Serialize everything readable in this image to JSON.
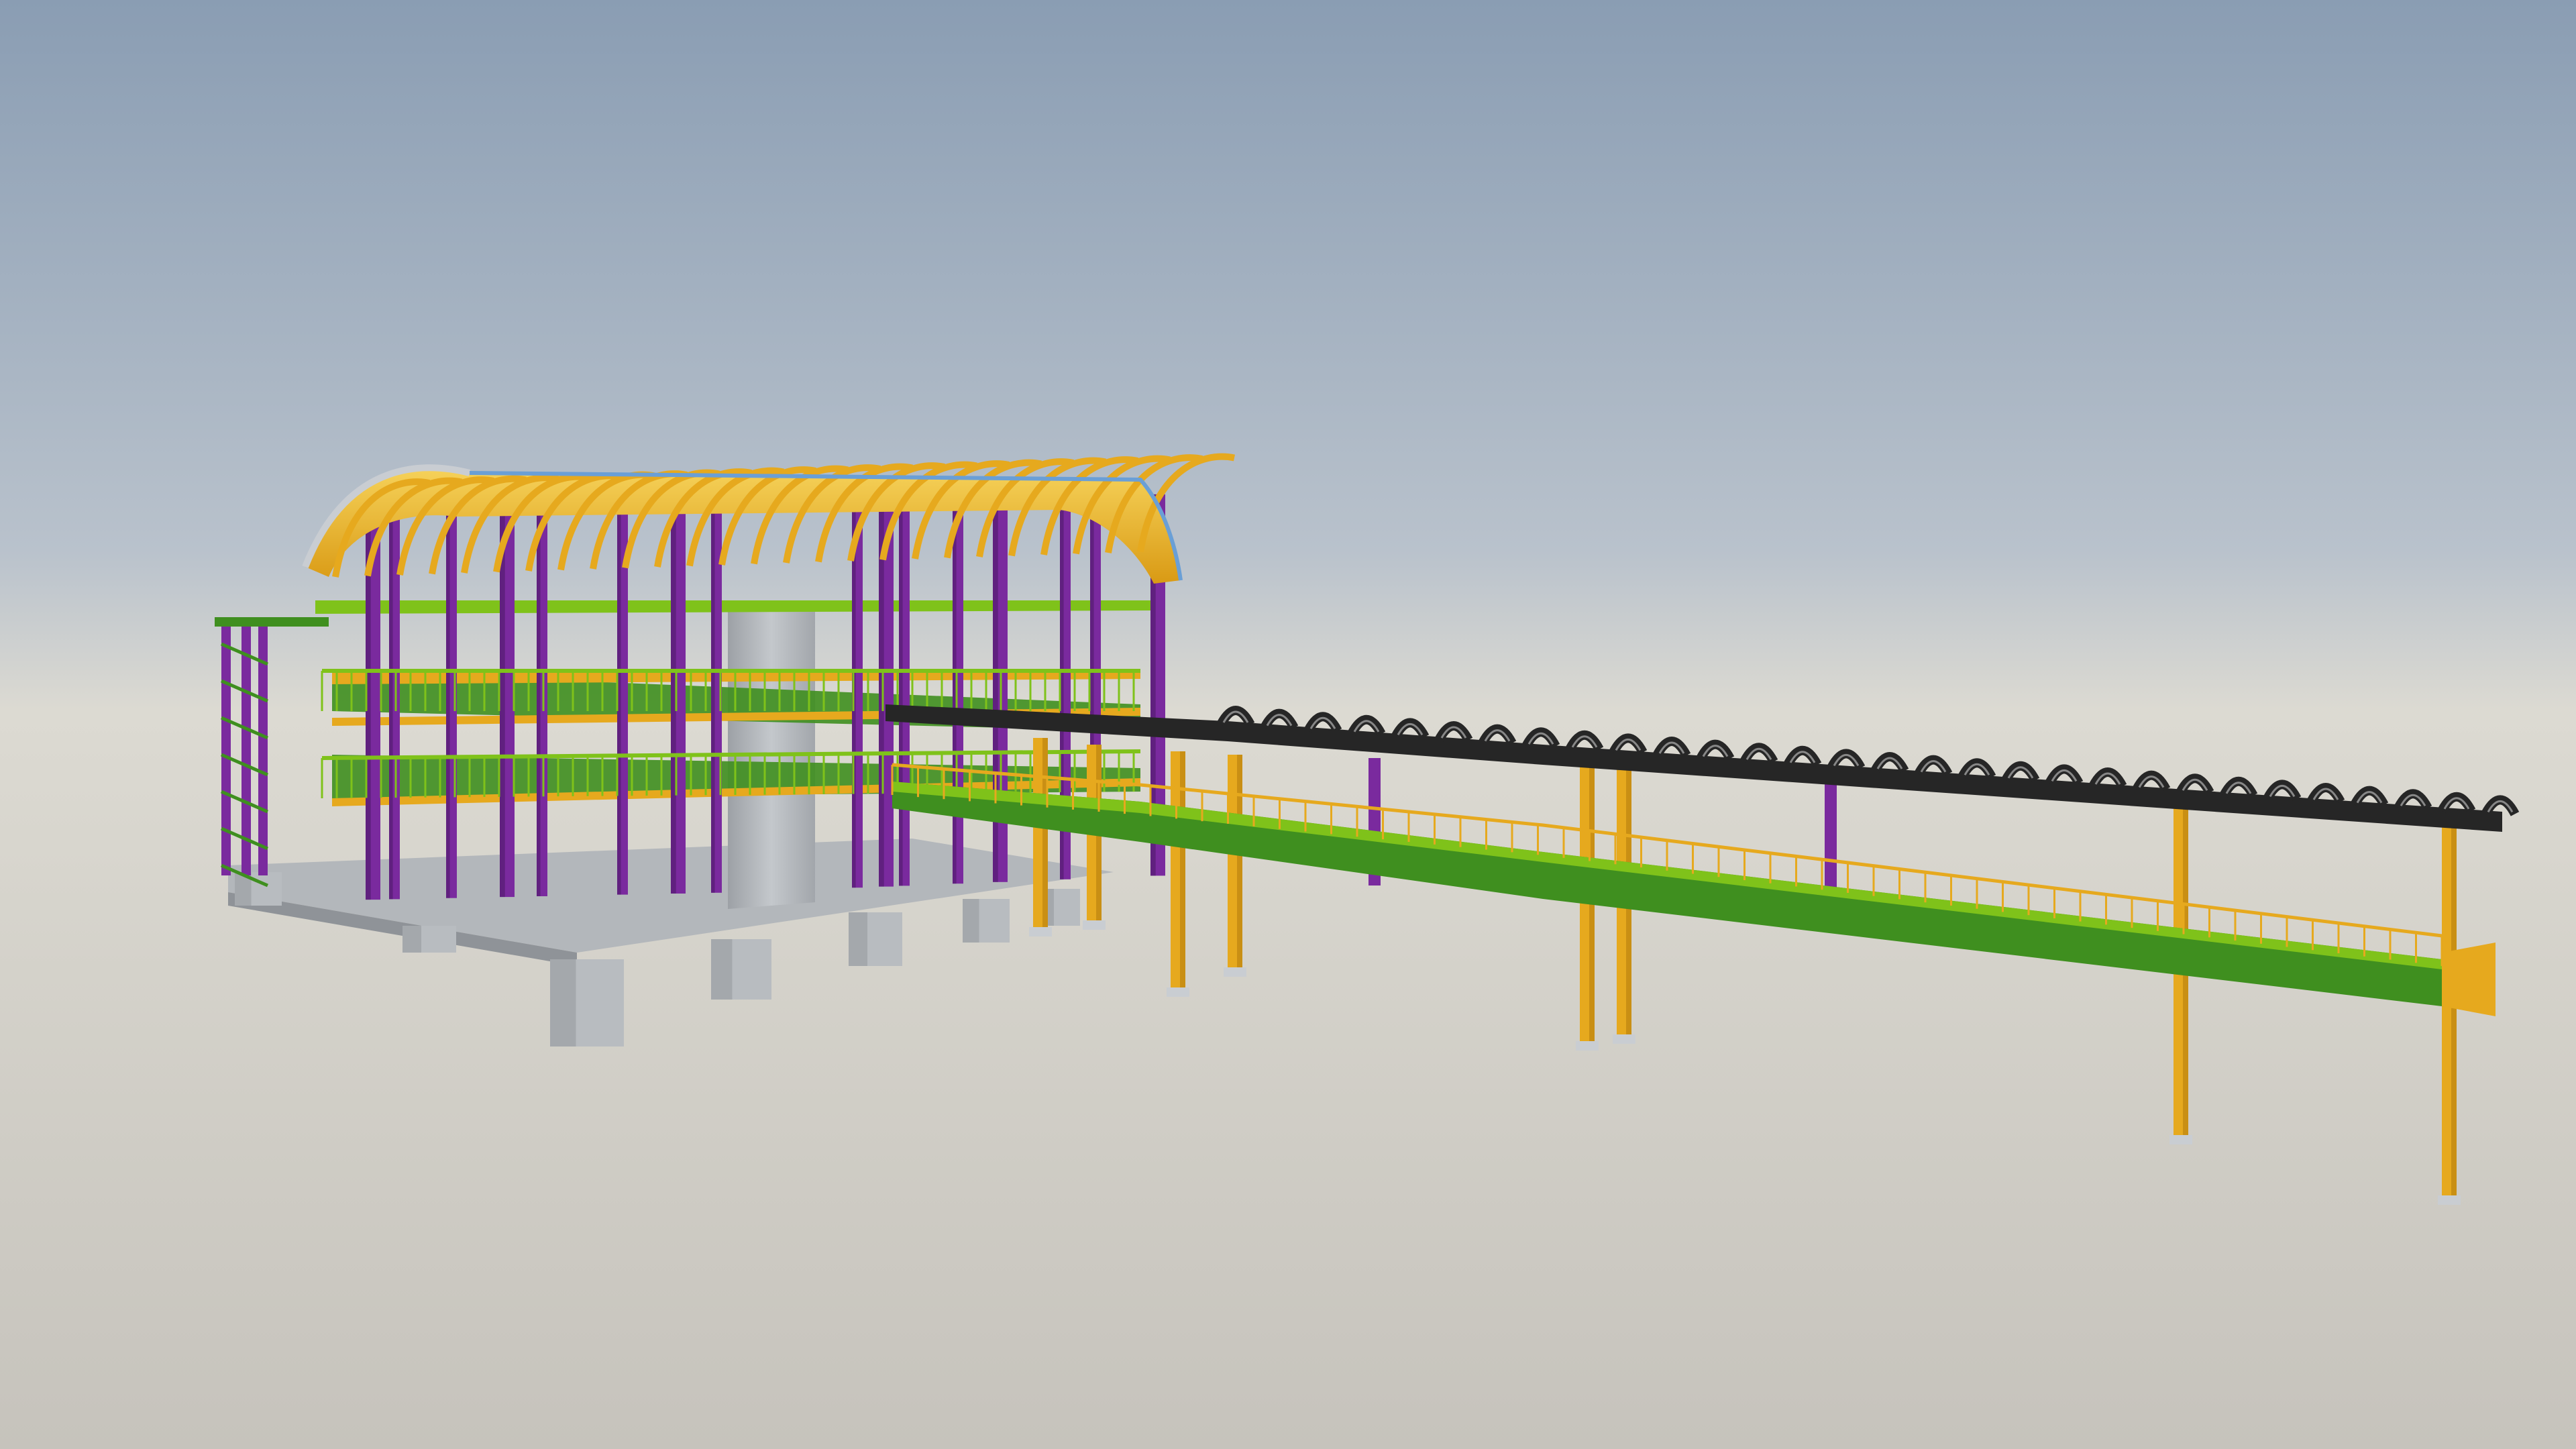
{
  "scene": {
    "colors": {
      "sky_top": "#8a9db3",
      "sky_mid": "#b9c2cc",
      "horizon": "#dcdad2",
      "ground": "#c6c3bc",
      "purple": "#7a2a9e",
      "purple_dark": "#4f1a6b",
      "yellow": "#e6a91e",
      "yellow_light": "#f3c94a",
      "green": "#3f8f1f",
      "green_light": "#7fc21a",
      "concrete": "#b8bcc0",
      "concrete_dark": "#8f9398",
      "black": "#262626",
      "steel": "#c9cdd2"
    },
    "objects": {
      "building": "steel-frame-building-with-arched-roof",
      "core": "concrete-core-shaft",
      "bridge": "conveyor-gallery-bridge",
      "bridge_roof": "black-curved-rib-canopy",
      "supports": "yellow-trestle-columns",
      "foundations": "concrete-pile-caps"
    }
  }
}
